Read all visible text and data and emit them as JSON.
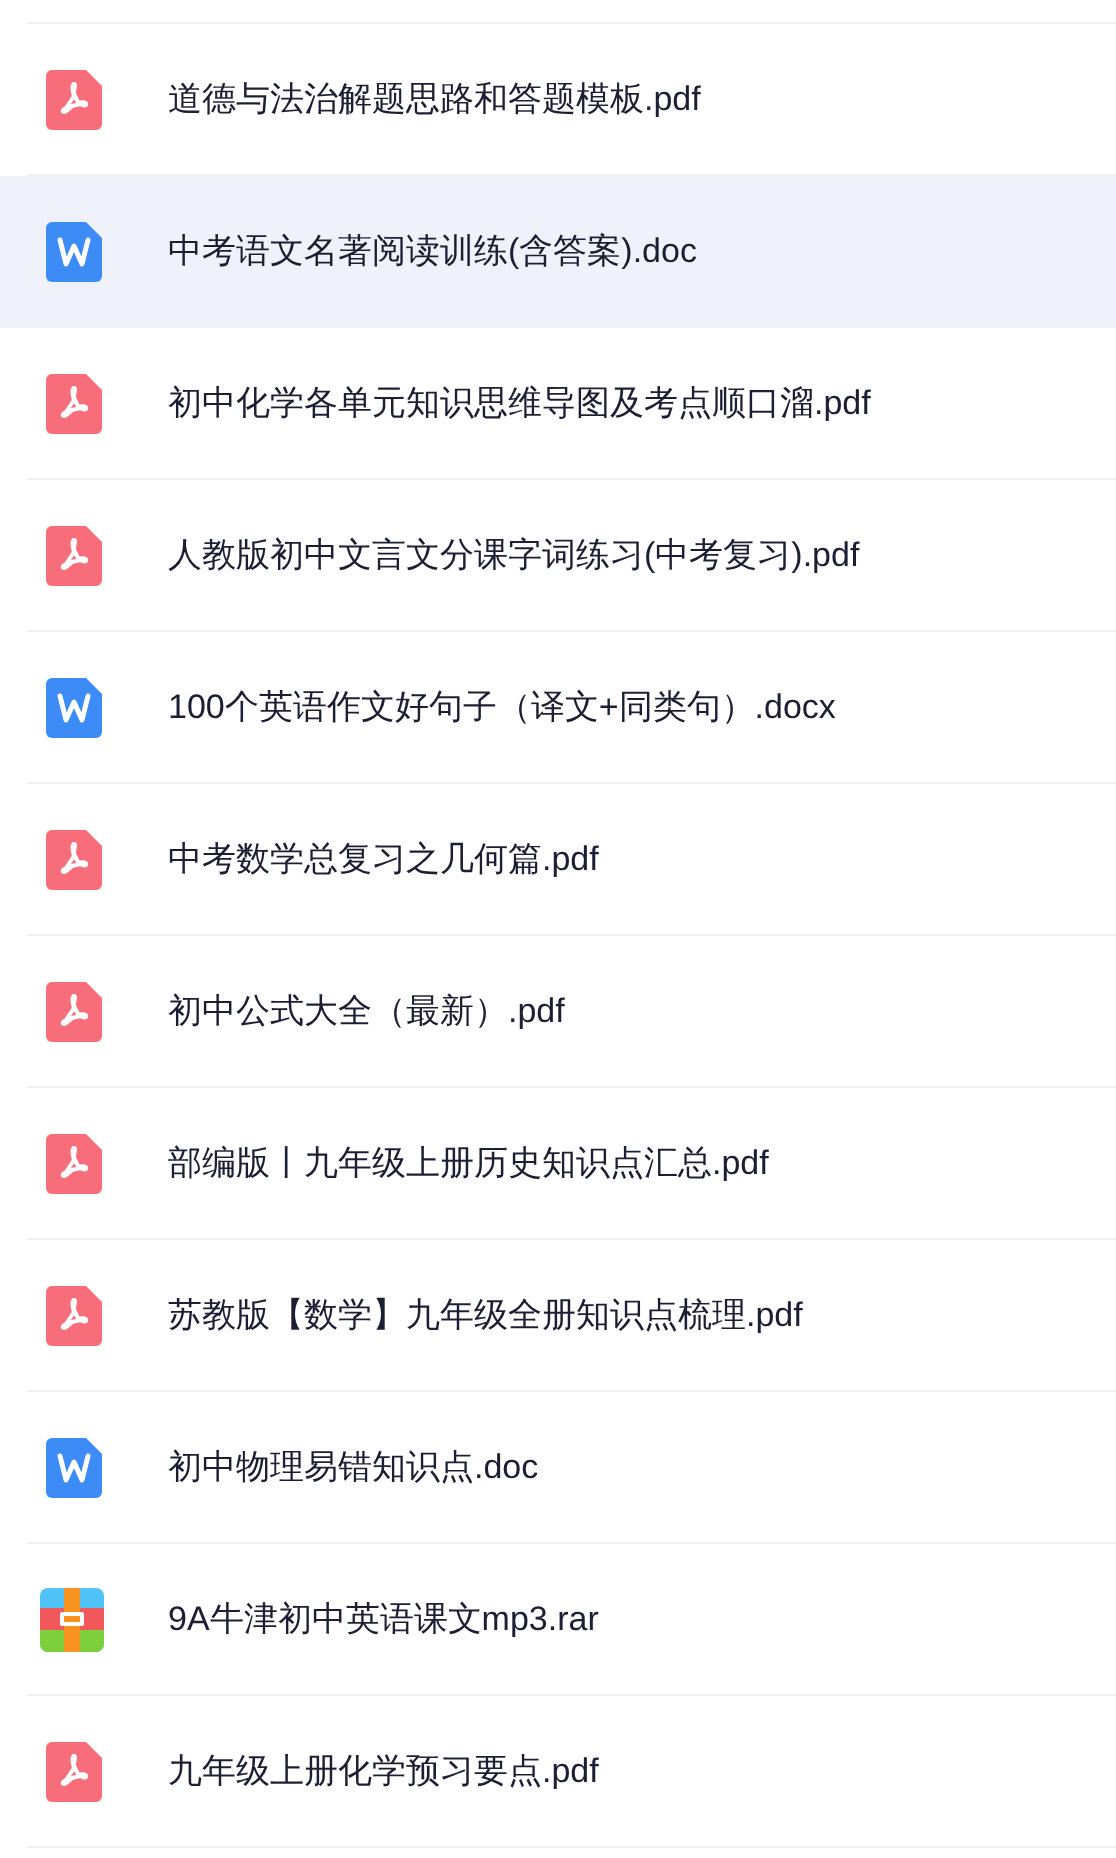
{
  "files": [
    {
      "name": "道德与法治解题思路和答题模板.pdf",
      "kind": "pdf",
      "selected": false
    },
    {
      "name": "中考语文名著阅读训练(含答案).doc",
      "kind": "word",
      "selected": true
    },
    {
      "name": "初中化学各单元知识思维导图及考点顺口溜.pdf",
      "kind": "pdf",
      "selected": false
    },
    {
      "name": "人教版初中文言文分课字词练习(中考复习).pdf",
      "kind": "pdf",
      "selected": false
    },
    {
      "name": "100个英语作文好句子（译文+同类句）.docx",
      "kind": "word",
      "selected": false
    },
    {
      "name": "中考数学总复习之几何篇.pdf",
      "kind": "pdf",
      "selected": false
    },
    {
      "name": "初中公式大全（最新）.pdf",
      "kind": "pdf",
      "selected": false
    },
    {
      "name": "部编版丨九年级上册历史知识点汇总.pdf",
      "kind": "pdf",
      "selected": false
    },
    {
      "name": "苏教版【数学】九年级全册知识点梳理.pdf",
      "kind": "pdf",
      "selected": false
    },
    {
      "name": "初中物理易错知识点.doc",
      "kind": "word",
      "selected": false
    },
    {
      "name": "9A牛津初中英语课文mp3.rar",
      "kind": "archive",
      "selected": false
    },
    {
      "name": "九年级上册化学预习要点.pdf",
      "kind": "pdf",
      "selected": false
    }
  ]
}
